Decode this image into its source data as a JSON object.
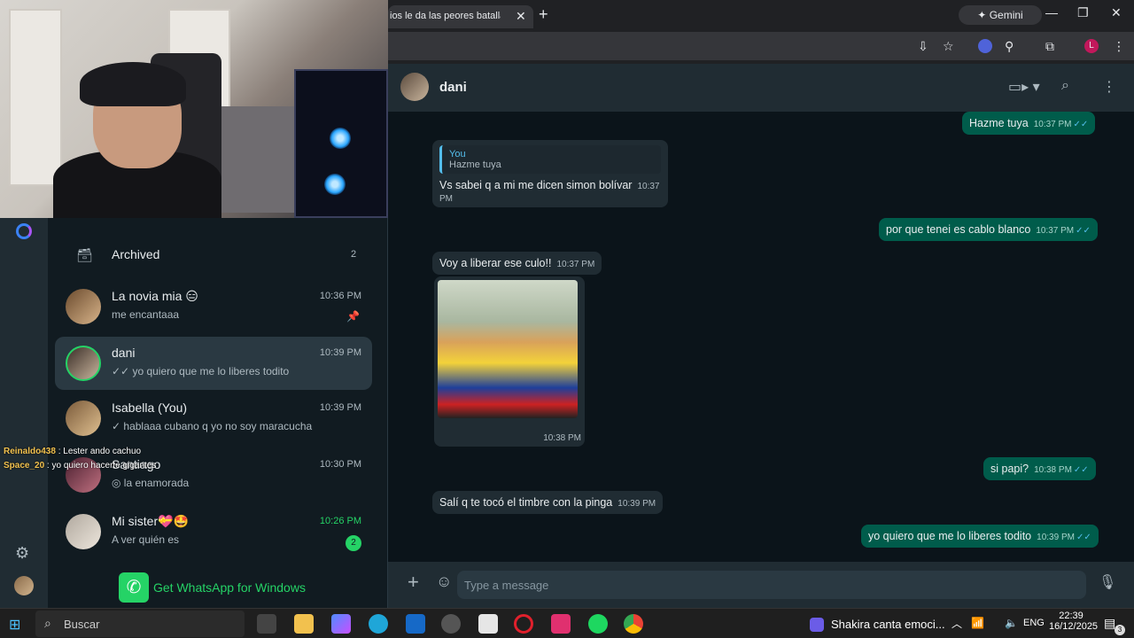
{
  "browser": {
    "tab_title": "ios le da las peores batallas a",
    "gemini_label": "Gemini"
  },
  "chat_list": {
    "archived_label": "Archived",
    "archived_count": "2",
    "items": [
      {
        "name": "La novia mia",
        "emoji": "😑",
        "preview": "me encantaaa",
        "time": "10:36 PM",
        "pinned": true
      },
      {
        "name": "dani",
        "preview": "✓✓ yo quiero que me lo liberes todito",
        "time": "10:39 PM",
        "active": true
      },
      {
        "name": "Isabella (You)",
        "preview": "✓ hablaaa cubano q yo no soy maracucha",
        "time": "10:39 PM"
      },
      {
        "name": "Santiago",
        "preview": "◎ la enamorada",
        "time": "10:30 PM"
      },
      {
        "name": "Mi sister",
        "emoji": "💝🤩",
        "preview": "A ver quién es",
        "time": "10:26 PM",
        "unread": "2"
      }
    ],
    "get_whatsapp": "Get WhatsApp for Windows"
  },
  "stream_chat": [
    {
      "user": "Reinaldo438",
      "msg": "Lester ando cachuo"
    },
    {
      "user": "Space_20",
      "msg": "yo quiero hacerte gigantes"
    }
  ],
  "chat": {
    "contact": "dani",
    "messages": [
      {
        "dir": "out",
        "text": "Hazme tuya",
        "time": "10:37 PM"
      },
      {
        "dir": "in",
        "quote_author": "You",
        "quote_text": "Hazme tuya",
        "text": "Vs sabei q a mi me dicen simon bolívar",
        "time": "10:37 PM"
      },
      {
        "dir": "out",
        "text": "por que tenei es cablo blanco",
        "time": "10:37 PM"
      },
      {
        "dir": "in",
        "text": "Voy a liberar ese culo!!",
        "time": "10:37 PM"
      },
      {
        "dir": "in",
        "image": true,
        "time": "10:38 PM"
      },
      {
        "dir": "out",
        "text": "si papi?",
        "time": "10:38 PM"
      },
      {
        "dir": "in",
        "text": "Salí q te tocó el timbre con la pinga",
        "time": "10:39 PM"
      },
      {
        "dir": "out",
        "text": "yo quiero que me lo liberes todito",
        "time": "10:39 PM"
      }
    ],
    "composer_placeholder": "Type a message"
  },
  "taskbar": {
    "search_placeholder": "Buscar",
    "now_playing": "Shakira canta emoci...",
    "lang": "ENG",
    "time": "22:39",
    "date": "16/12/2025",
    "notifications": "3"
  }
}
